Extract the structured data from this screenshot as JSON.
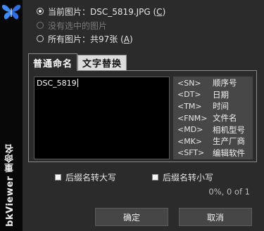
{
  "sidebar": {
    "app_title": "bkViewer 重命名"
  },
  "options": {
    "current_image": {
      "prefix": "当前图片：DSC_5819.JPG (",
      "key": "C",
      "suffix": ")"
    },
    "selected_images": "没有选中的图片",
    "all_images": {
      "prefix": "所有图片：共97张 (",
      "key": "A",
      "suffix": ")"
    }
  },
  "tabs": [
    {
      "label": "普通命名",
      "active": true
    },
    {
      "label": "文字替换",
      "active": false
    }
  ],
  "pattern_input": {
    "value": "DSC_5819"
  },
  "tokens": [
    {
      "code": "<SN>",
      "desc": "顺序号"
    },
    {
      "code": "<DT>",
      "desc": "日期"
    },
    {
      "code": "<TM>",
      "desc": "时间"
    },
    {
      "code": "<FNM>",
      "desc": "文件名"
    },
    {
      "code": "<MD>",
      "desc": "相机型号"
    },
    {
      "code": "<MK>",
      "desc": "生产厂商"
    },
    {
      "code": "<SFT>",
      "desc": "编辑软件"
    }
  ],
  "checkboxes": {
    "ext_upper": "后缀名转大写",
    "ext_lower": "后缀名转小写"
  },
  "progress": "0%, 0 of 1",
  "buttons": {
    "ok": "确定",
    "cancel": "取消"
  },
  "colors": {
    "background": "#2b2b2b",
    "sidebar": "#080808",
    "logo": "#3d8bff"
  }
}
